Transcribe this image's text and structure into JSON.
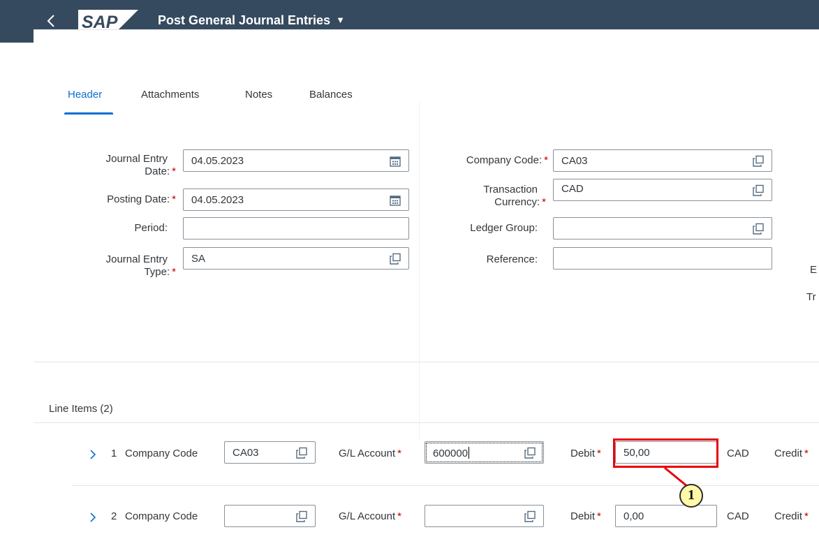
{
  "shell": {
    "logo_text": "SAP",
    "app_title": "Post General Journal Entries",
    "title_caret": "▼"
  },
  "tabs": [
    "Header",
    "Attachments",
    "Notes",
    "Balances"
  ],
  "header_form": {
    "journal_entry_date": {
      "label_line1": "Journal Entry",
      "label_line2": "Date:",
      "value": "04.05.2023"
    },
    "posting_date": {
      "label": "Posting Date:",
      "value": "04.05.2023"
    },
    "period": {
      "label": "Period:",
      "value": ""
    },
    "journal_entry_type": {
      "label_line1": "Journal Entry",
      "label_line2": "Type:",
      "value": "SA"
    },
    "company_code": {
      "label": "Company Code:",
      "value": "CA03"
    },
    "transaction_currency": {
      "label_line1": "Transaction",
      "label_line2": "Currency:",
      "value": "CAD"
    },
    "ledger_group": {
      "label": "Ledger Group:",
      "value": ""
    },
    "reference": {
      "label": "Reference:",
      "value": ""
    },
    "cut_off_1": "E",
    "cut_off_2": "Tr"
  },
  "required_marker": "*",
  "line_items": {
    "title": "Line Items (2)",
    "rows": [
      {
        "number": "1",
        "company_code_label": "Company Code",
        "company_code": "CA03",
        "gl_label": "G/L Account",
        "gl_account": "600000",
        "debit_label": "Debit",
        "debit": "50,00",
        "currency": "CAD",
        "credit_label": "Credit"
      },
      {
        "number": "2",
        "company_code_label": "Company Code",
        "company_code": "",
        "gl_label": "G/L Account",
        "gl_account": "",
        "debit_label": "Debit",
        "debit": "0,00",
        "currency": "CAD",
        "credit_label": "Credit"
      }
    ]
  },
  "annotation": {
    "callout_number": "1",
    "highlight_color": "#e8000a"
  },
  "colors": {
    "shell": "#354a5f",
    "accent": "#0a6ed1",
    "required": "#bb0000"
  }
}
